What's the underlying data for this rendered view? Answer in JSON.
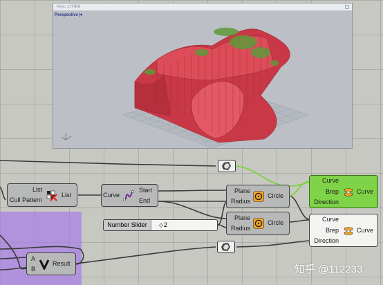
{
  "viewport": {
    "window_title": "Rhino 工作视窗",
    "view_label": "Perspective",
    "view_menu_glyph": "|▾"
  },
  "components": {
    "cull_pattern": {
      "input_list": "List",
      "input_pattern": "Cull Pattern",
      "output": "List",
      "icon": "cull-pattern-icon"
    },
    "curve_ends": {
      "input": "Curve",
      "output_start": "Start",
      "output_end": "End",
      "icon": "curve-icon"
    },
    "circle_top": {
      "input_plane": "Plane",
      "input_radius": "Radius",
      "output": "Circle",
      "icon": "circle-icon"
    },
    "circle_bottom": {
      "input_plane": "Plane",
      "input_radius": "Radius",
      "output": "Circle",
      "icon": "circle-icon"
    },
    "sweep_top": {
      "input_curve": "Curve",
      "input_brep": "Brep",
      "input_direction": "Direction",
      "output": "Curve",
      "icon": "sweep-icon",
      "state": "selected"
    },
    "sweep_bottom": {
      "input_curve": "Curve",
      "input_brep": "Brep",
      "input_direction": "Direction",
      "output": "Curve",
      "icon": "sweep-icon"
    },
    "bool_and": {
      "input_a": "A",
      "input_b": "B",
      "output": "Result",
      "icon": "and-gate-icon"
    }
  },
  "slider": {
    "label": "Number Slider",
    "value": "2",
    "knob_glyph": "◇"
  },
  "watermark": "知乎 @112233",
  "colors": {
    "canvas": "#c8c8c3",
    "component": "#b7b8b8",
    "selected_component": "#7fd348",
    "group": "#aa82e6",
    "surface": "#d64653",
    "vegetation": "#5e9a3a"
  }
}
